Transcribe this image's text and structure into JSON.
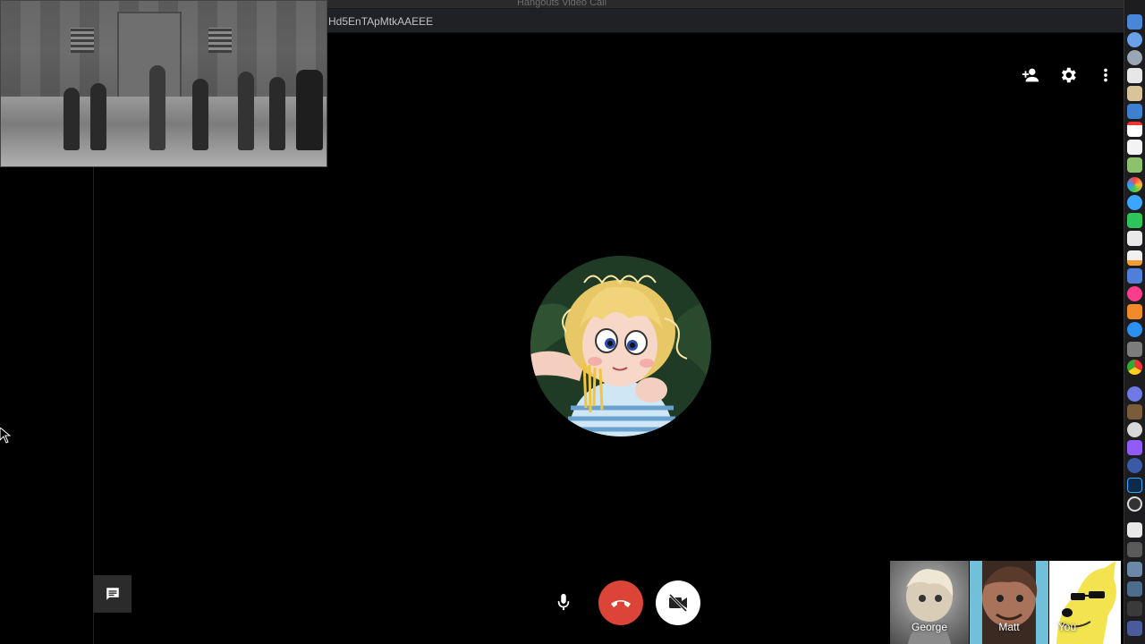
{
  "window": {
    "title": "Hangouts Video Call",
    "url_fragment": "Hd5EnTApMtkAAEEE"
  },
  "top_controls": {
    "add_person_icon": "person-add-icon",
    "settings_icon": "gear-icon",
    "more_icon": "more-vert-icon"
  },
  "bottom_controls": {
    "mic_icon": "microphone-icon",
    "hangup_icon": "hang-up-icon",
    "video_icon": "video-off-icon",
    "chat_icon": "chat-icon"
  },
  "participants": [
    {
      "name": "George"
    },
    {
      "name": "Matt"
    },
    {
      "name": "You"
    }
  ],
  "colors": {
    "hangup": "#db4437",
    "video_btn": "#ffffff",
    "background": "#000000"
  }
}
